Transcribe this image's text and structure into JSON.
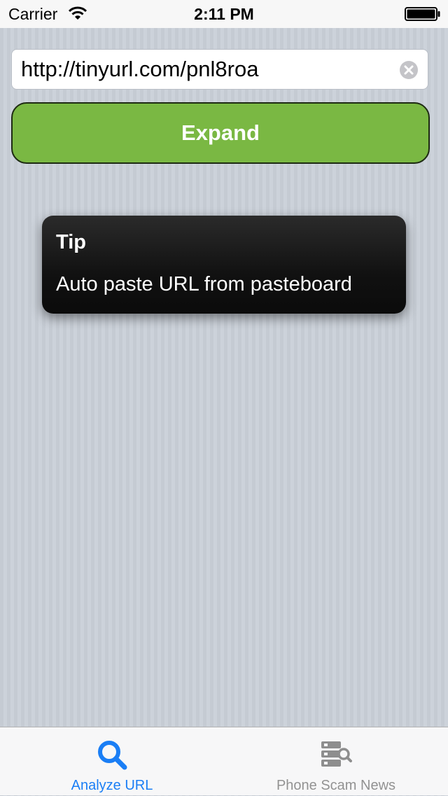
{
  "status_bar": {
    "carrier": "Carrier",
    "time": "2:11 PM",
    "wifi_icon": "wifi-icon",
    "battery_icon": "battery-icon"
  },
  "url_field": {
    "value": "http://tinyurl.com/pnl8roa",
    "clear_icon": "clear-icon"
  },
  "expand_button": {
    "label": "Expand",
    "color": "#7ab843"
  },
  "tip": {
    "title": "Tip",
    "message": "Auto paste URL from pasteboard"
  },
  "tab_bar": {
    "tabs": [
      {
        "label": "Analyze URL",
        "icon": "search-icon",
        "selected": true,
        "color": "#1a7ef5"
      },
      {
        "label": "Phone Scam News",
        "icon": "server-search-icon",
        "selected": false,
        "color": "#929292"
      }
    ]
  }
}
